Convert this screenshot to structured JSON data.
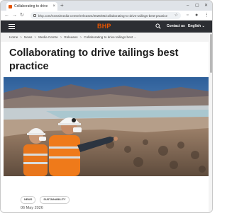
{
  "browser": {
    "tab_title": "Collaborating to drive",
    "url": "bhp.com/news/media-centre/releases/2026/05/collaborating-to-drive-tailings-best-practice"
  },
  "site": {
    "logo": "BHP",
    "contact_label": "Contact us",
    "language_label": "English",
    "brand_color": "#e65400",
    "header_color": "#2c2e33"
  },
  "breadcrumb": [
    "Home",
    "News",
    "Media Centre",
    "Releases",
    "Collaborating to drive tailings best ..."
  ],
  "article": {
    "title": "Collaborating to drive tailings best practice",
    "tags": [
      "NEWS",
      "SUSTAINABILITY"
    ],
    "date": "06 May 2026"
  }
}
